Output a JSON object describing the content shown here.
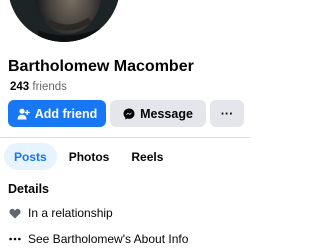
{
  "profile": {
    "name": "Bartholomew Macomber",
    "friend_count": "243",
    "friends_label": "friends"
  },
  "actions": {
    "add_friend_label": "Add friend",
    "message_label": "Message",
    "more_label": "···"
  },
  "tabs": [
    {
      "label": "Posts",
      "active": true
    },
    {
      "label": "Photos",
      "active": false
    },
    {
      "label": "Reels",
      "active": false
    }
  ],
  "details": {
    "title": "Details",
    "items": [
      {
        "icon": "heart-icon",
        "text": "In a relationship"
      },
      {
        "icon": "more-dots-icon",
        "text": "See Bartholomew's About Info"
      }
    ]
  },
  "colors": {
    "accent": "#1877f2",
    "secondary_button": "#e4e6eb",
    "active_tab_bg": "#e7f3ff",
    "muted_text": "#65676b"
  }
}
